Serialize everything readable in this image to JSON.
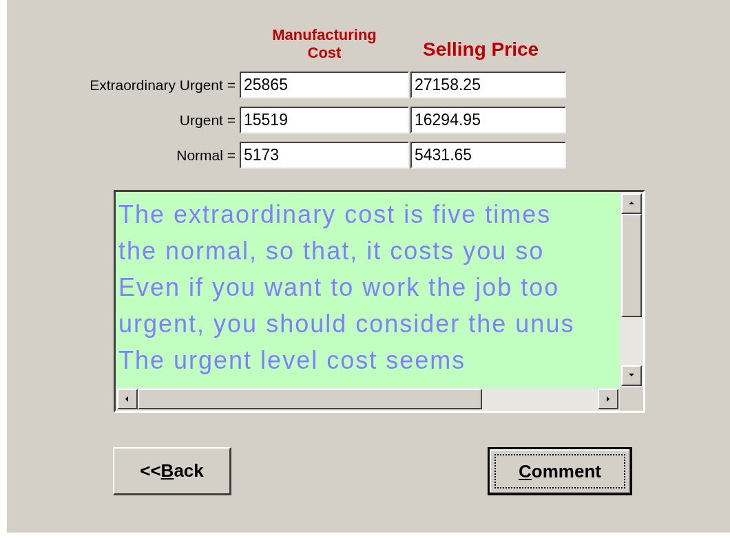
{
  "headers": [
    {
      "label": "Manufacturing Cost"
    },
    {
      "label": "Selling Price"
    }
  ],
  "rows": [
    {
      "label": "Extraordinary Urgent =",
      "cost": "25865",
      "price": "27158.25"
    },
    {
      "label": "Urgent =",
      "cost": "15519",
      "price": "16294.95"
    },
    {
      "label": "Normal =",
      "cost": "5173",
      "price": "5431.65"
    }
  ],
  "comment_lines": [
    "The extraordinary cost is five times",
    "the normal, so that, it costs you so",
    "Even if you want to work the job too",
    "urgent, you should consider the unus",
    "The urgent level cost seems"
  ],
  "buttons": [
    {
      "before_key": "<<",
      "access_key": "B",
      "after_key": "ack",
      "focused": false
    },
    {
      "access_key": "C",
      "after_key": "omment",
      "focused": true
    }
  ]
}
